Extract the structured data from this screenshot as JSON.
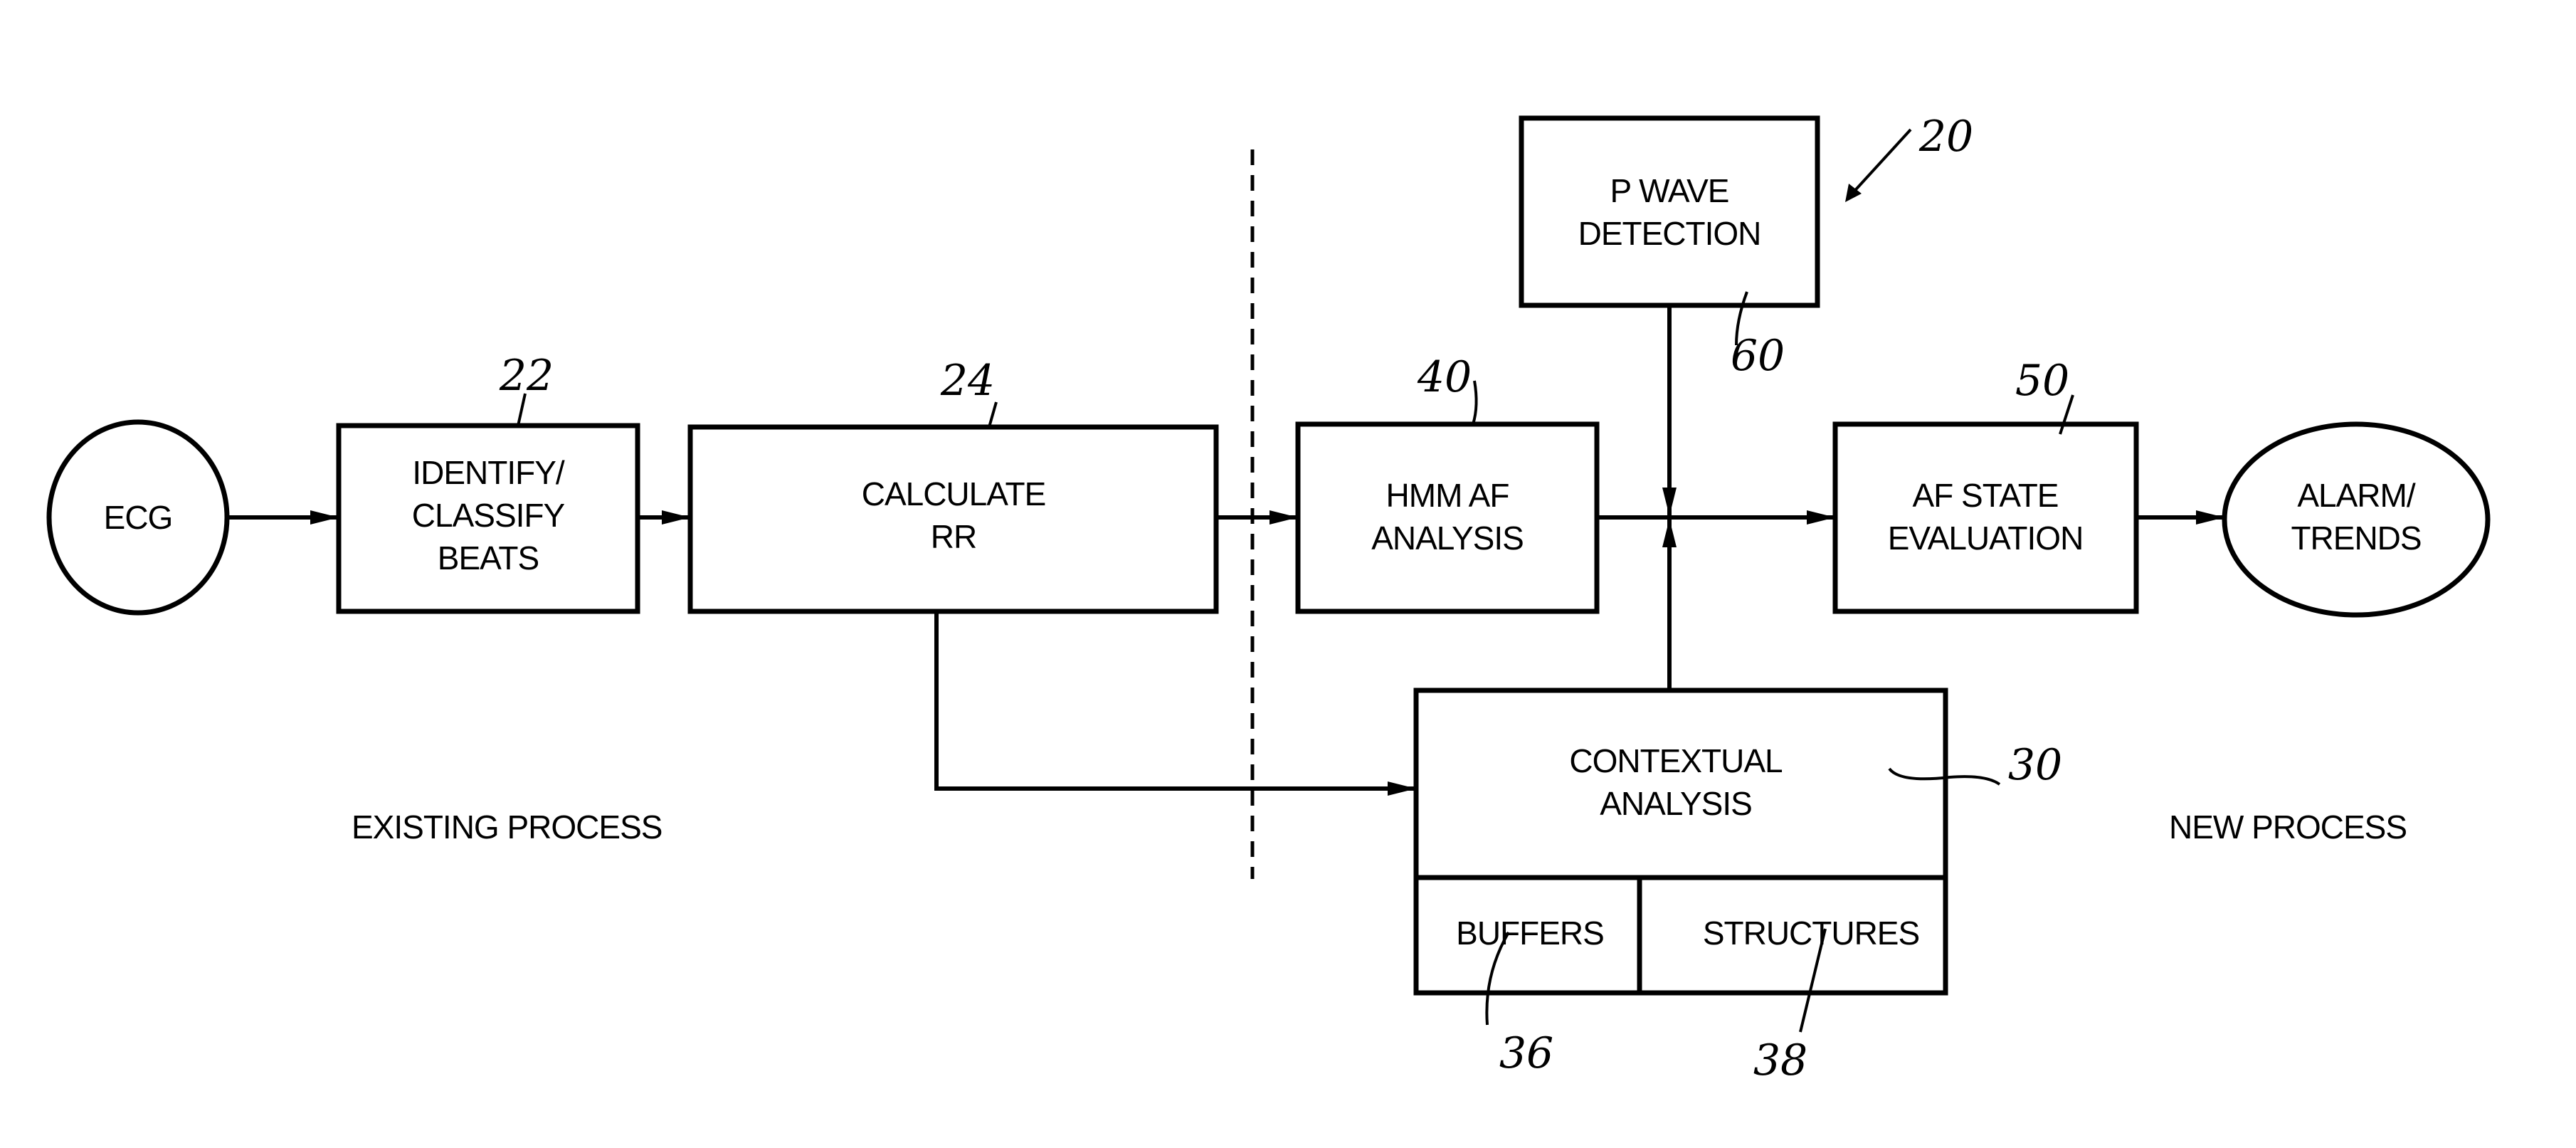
{
  "diagram": {
    "figure_ref": "20",
    "nodes": {
      "ecg": {
        "lines": [
          "ECG"
        ]
      },
      "identify": {
        "lines": [
          "IDENTIFY/",
          "CLASSIFY",
          "BEATS"
        ],
        "ref": "22"
      },
      "calc_rr": {
        "lines": [
          "CALCULATE",
          "RR"
        ],
        "ref": "24"
      },
      "hmm": {
        "lines": [
          "HMM AF",
          "ANALYSIS"
        ],
        "ref": "40"
      },
      "pwave": {
        "lines": [
          "P WAVE",
          "DETECTION"
        ],
        "ref": "60"
      },
      "afstate": {
        "lines": [
          "AF STATE",
          "EVALUATION"
        ],
        "ref": "50"
      },
      "alarm": {
        "lines": [
          "ALARM/",
          "TRENDS"
        ]
      },
      "contextual": {
        "lines": [
          "CONTEXTUAL",
          "ANALYSIS"
        ],
        "ref": "30"
      },
      "buffers": {
        "lines": [
          "BUFFERS"
        ],
        "ref": "36"
      },
      "structures": {
        "lines": [
          "STRUCTURES"
        ],
        "ref": "38"
      }
    },
    "captions": {
      "existing": "EXISTING PROCESS",
      "new": "NEW PROCESS"
    },
    "edges": [
      {
        "from": "ecg",
        "to": "identify"
      },
      {
        "from": "identify",
        "to": "calc_rr"
      },
      {
        "from": "calc_rr",
        "to": "hmm"
      },
      {
        "from": "calc_rr",
        "to": "contextual"
      },
      {
        "from": "hmm",
        "to": "afstate"
      },
      {
        "from": "pwave",
        "to": "afstate"
      },
      {
        "from": "contextual",
        "to": "afstate"
      },
      {
        "from": "afstate",
        "to": "alarm"
      }
    ]
  }
}
